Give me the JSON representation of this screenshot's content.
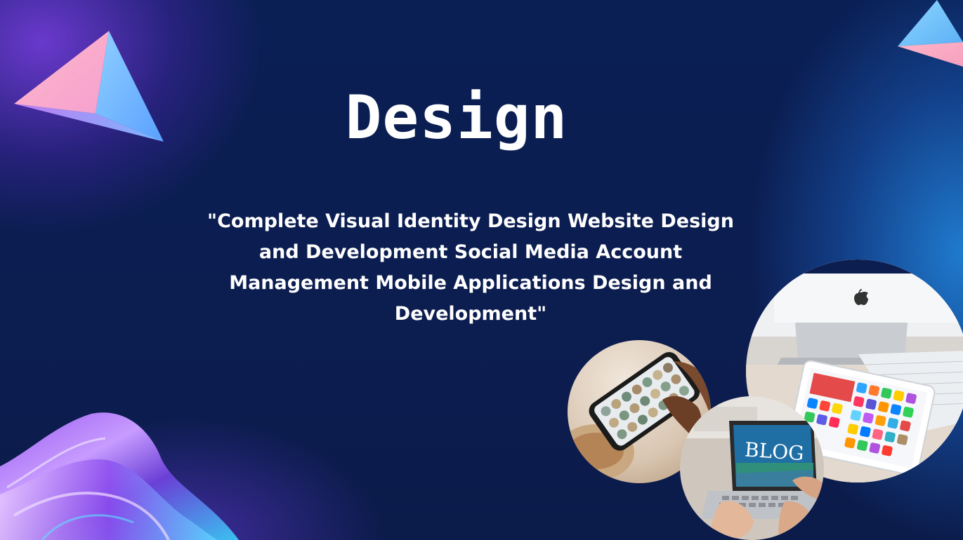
{
  "slide": {
    "title": "Design",
    "subtitle": "\"Complete Visual Identity Design Website Design and Development Social Media Account Management Mobile Applications Design and Development\"",
    "colors": {
      "background": "#0b1c4d",
      "accent_purple": "#8a42f5",
      "accent_blue": "#2080d6",
      "text": "#ffffff"
    }
  },
  "images": {
    "imac_photo": "imac-tablet-photo",
    "phone_photo": "smartphone-photo",
    "blog_photo": "blog-laptop-photo",
    "blog_screen_text": "BLOG"
  }
}
